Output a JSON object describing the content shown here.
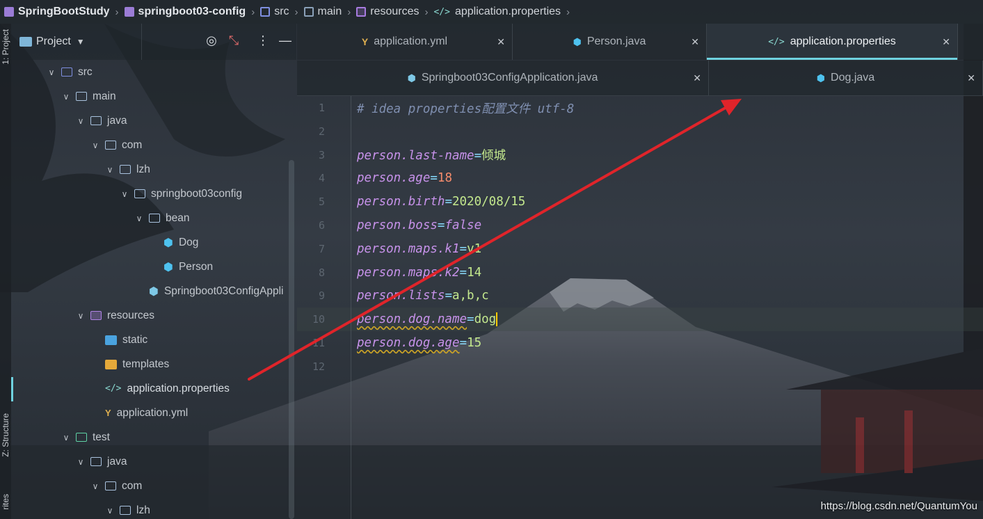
{
  "breadcrumb": {
    "items": [
      "SpringBootStudy",
      "springboot03-config",
      "src",
      "main",
      "resources",
      "application.properties"
    ]
  },
  "toolstrip": {
    "project_label": "1: Project",
    "structure_label": "Z: Structure",
    "favorites_label": "rites"
  },
  "project_panel": {
    "title": "Project",
    "tree": [
      {
        "label": "src",
        "depth": 2,
        "icon": "src-folder-icon",
        "expanded": true
      },
      {
        "label": "main",
        "depth": 3,
        "icon": "folder-icon",
        "expanded": true
      },
      {
        "label": "java",
        "depth": 4,
        "icon": "folder-icon",
        "expanded": true
      },
      {
        "label": "com",
        "depth": 5,
        "icon": "folder-icon",
        "expanded": true
      },
      {
        "label": "lzh",
        "depth": 6,
        "icon": "folder-icon",
        "expanded": true
      },
      {
        "label": "springboot03config",
        "depth": 7,
        "icon": "folder-icon",
        "expanded": true
      },
      {
        "label": "bean",
        "depth": 8,
        "icon": "folder-icon",
        "expanded": true
      },
      {
        "label": "Dog",
        "depth": 9,
        "icon": "java-class-icon"
      },
      {
        "label": "Person",
        "depth": 9,
        "icon": "java-class-icon"
      },
      {
        "label": "Springboot03ConfigAppli",
        "depth": 8,
        "icon": "spring-app-icon"
      },
      {
        "label": "resources",
        "depth": 4,
        "icon": "resources-folder-icon",
        "expanded": true
      },
      {
        "label": "static",
        "depth": 5,
        "icon": "static-folder-icon"
      },
      {
        "label": "templates",
        "depth": 5,
        "icon": "templates-folder-icon"
      },
      {
        "label": "application.properties",
        "depth": 5,
        "icon": "properties-file-icon",
        "selected": true
      },
      {
        "label": "application.yml",
        "depth": 5,
        "icon": "yml-file-icon"
      },
      {
        "label": "test",
        "depth": 3,
        "icon": "test-folder-icon",
        "expanded": true
      },
      {
        "label": "java",
        "depth": 4,
        "icon": "folder-icon",
        "expanded": true
      },
      {
        "label": "com",
        "depth": 5,
        "icon": "folder-icon",
        "expanded": true
      },
      {
        "label": "lzh",
        "depth": 6,
        "icon": "folder-icon",
        "expanded": true
      }
    ]
  },
  "tabs": {
    "row1": [
      {
        "label": "application.yml",
        "icon": "yml-file-icon"
      },
      {
        "label": "Person.java",
        "icon": "java-class-icon"
      },
      {
        "label": "application.properties",
        "icon": "properties-file-icon",
        "active": true
      }
    ],
    "row2": [
      {
        "label": "Springboot03ConfigApplication.java",
        "icon": "spring-app-icon"
      },
      {
        "label": "Dog.java",
        "icon": "java-class-icon"
      }
    ]
  },
  "editor": {
    "lines": [
      {
        "n": "1",
        "comment": "# idea properties配置文件 utf-8"
      },
      {
        "n": "2"
      },
      {
        "n": "3",
        "key": "person.last-name",
        "value": "倾城",
        "vtype": "val"
      },
      {
        "n": "4",
        "key": "person.age",
        "value": "18",
        "vtype": "num"
      },
      {
        "n": "5",
        "key": "person.birth",
        "value": "2020/08/15",
        "vtype": "val"
      },
      {
        "n": "6",
        "key": "person.boss",
        "value": "false",
        "vtype": "bool"
      },
      {
        "n": "7",
        "key": "person.maps.k1",
        "value": "v1",
        "vtype": "val"
      },
      {
        "n": "8",
        "key": "person.maps.k2",
        "value": "14",
        "vtype": "val"
      },
      {
        "n": "9",
        "key": "person.lists",
        "value": "a,b,c",
        "vtype": "val"
      },
      {
        "n": "10",
        "key": "person.dog.name",
        "value": "dog",
        "vtype": "val",
        "current": true,
        "warn": true
      },
      {
        "n": "11",
        "key": "person.dog.age",
        "value": "15",
        "vtype": "val",
        "warn": true
      },
      {
        "n": "12"
      }
    ]
  },
  "watermark": "https://blog.csdn.net/QuantumYou",
  "colors": {
    "accent": "#6fd2e0",
    "arrow": "#e0242a",
    "key": "#c792ea",
    "value": "#c3e88d",
    "number": "#f78c6c"
  }
}
